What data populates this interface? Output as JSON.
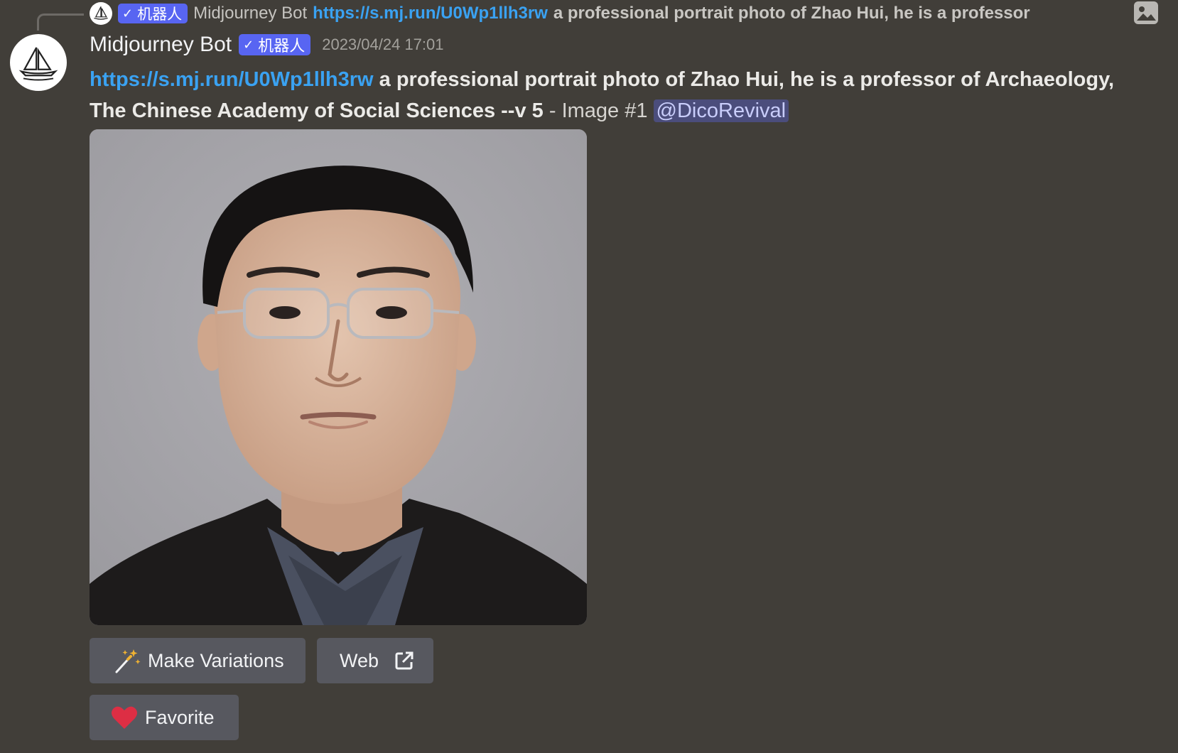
{
  "reply_preview": {
    "badge_check": "✓",
    "badge_label": "机器人",
    "author": "Midjourney Bot",
    "link": "https://s.mj.run/U0Wp1llh3rw",
    "text": "a professional portrait photo of Zhao Hui, he is a professor",
    "attachment_icon": "image-icon"
  },
  "message": {
    "author": "Midjourney Bot",
    "badge_check": "✓",
    "badge_label": "机器人",
    "timestamp": "2023/04/24 17:01",
    "link": "https://s.mj.run/U0Wp1llh3rw",
    "prompt": "a professional portrait photo of Zhao Hui, he is a professor of Archaeology, The Chinese Academy of Social Sciences --v 5",
    "separator": " - ",
    "image_label": "Image #1",
    "mention": "@DicoRevival"
  },
  "buttons": {
    "make_variations": "Make Variations",
    "web": "Web",
    "favorite": "Favorite"
  },
  "colors": {
    "background": "#413e39",
    "link": "#3aa2f2",
    "badge": "#5865f2",
    "button": "#57585f",
    "mention_bg": "#4b4d7c"
  }
}
